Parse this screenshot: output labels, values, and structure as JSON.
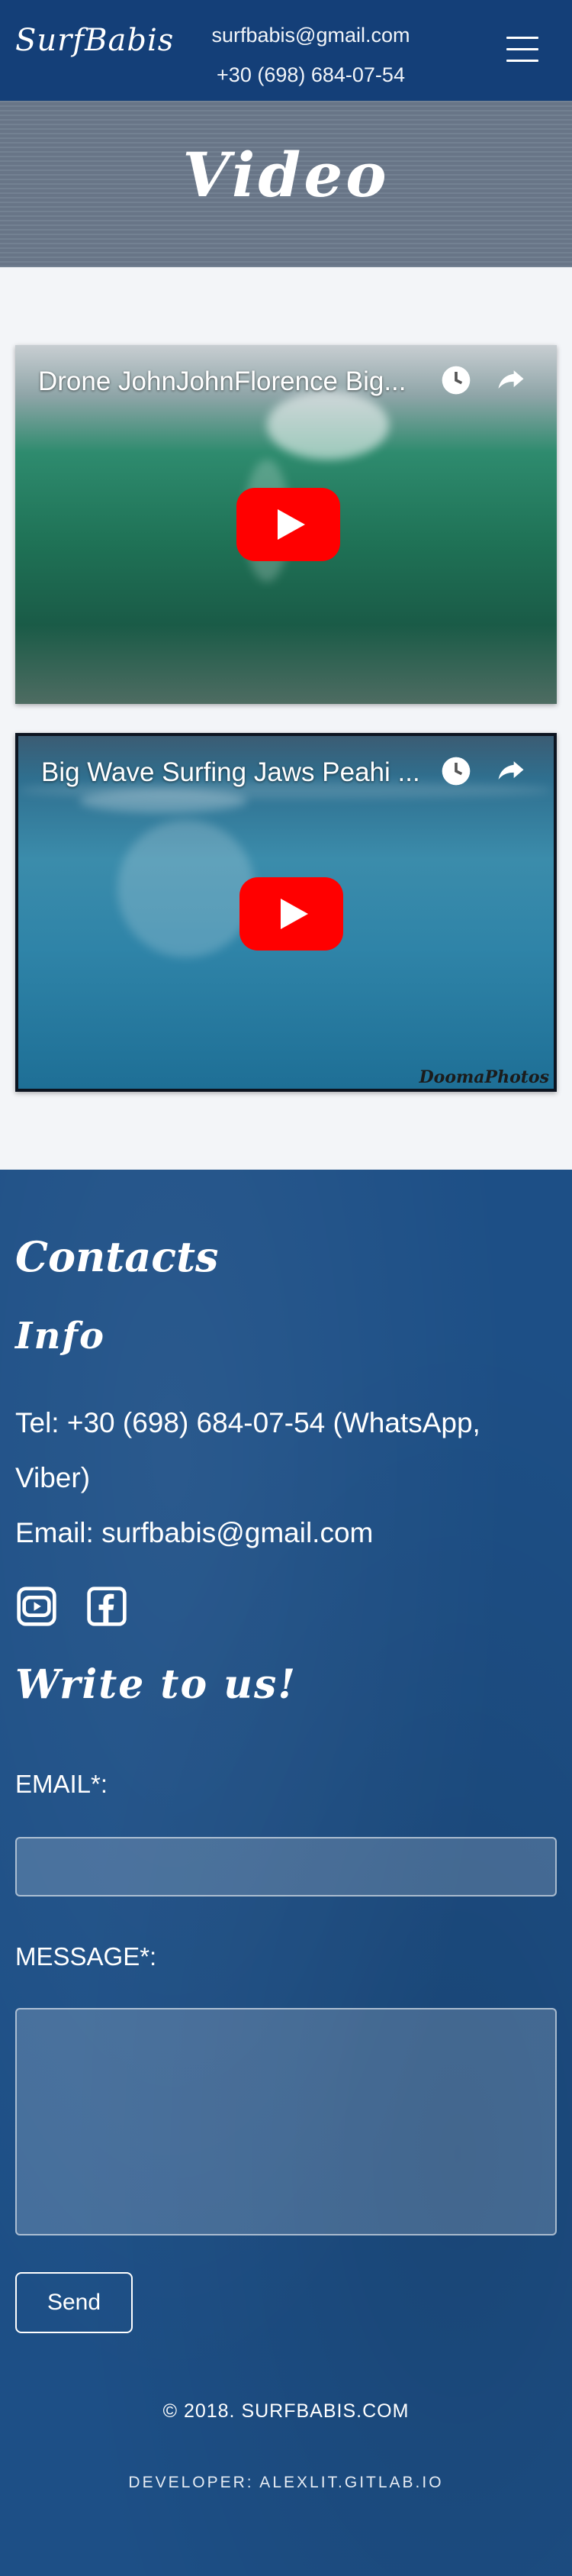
{
  "header": {
    "logo": "SurfBabis",
    "email": "surfbabis@gmail.com",
    "phone": "+30 (698) 684-07-54",
    "menu_icon": "hamburger-menu-icon"
  },
  "banner": {
    "title": "Video"
  },
  "videos": [
    {
      "title": "Drone JohnJohnFlorence Big...",
      "watch_later_icon": "clock-icon",
      "share_icon": "share-icon",
      "play_icon": "youtube-play-icon"
    },
    {
      "title": "Big Wave Surfing Jaws Peahi ...",
      "watch_later_icon": "clock-icon",
      "share_icon": "share-icon",
      "play_icon": "youtube-play-icon",
      "watermark": "DoomaPhotos"
    }
  ],
  "footer": {
    "contacts_heading": "Contacts",
    "info_heading": "Info",
    "tel_line": "Tel: +30 (698) 684-07-54 (WhatsApp, Viber)",
    "email_line": "Email: surfbabis@gmail.com",
    "social_icons": [
      "youtube-icon",
      "facebook-icon"
    ],
    "write_heading": "Write to us!",
    "email_label": "EMAIL*:",
    "email_value": "",
    "message_label": "MESSAGE*:",
    "message_value": "",
    "send_label": "Send",
    "copyright": "© 2018. SURFBABIS.COM",
    "developer": "DEVELOPER: ALEXLIT.GITLAB.IO"
  },
  "colors": {
    "header_bg": "#143f78",
    "banner_bg": "#6c7a8c",
    "footer_bg": "#1d4f86",
    "play_red": "#ff0000"
  }
}
